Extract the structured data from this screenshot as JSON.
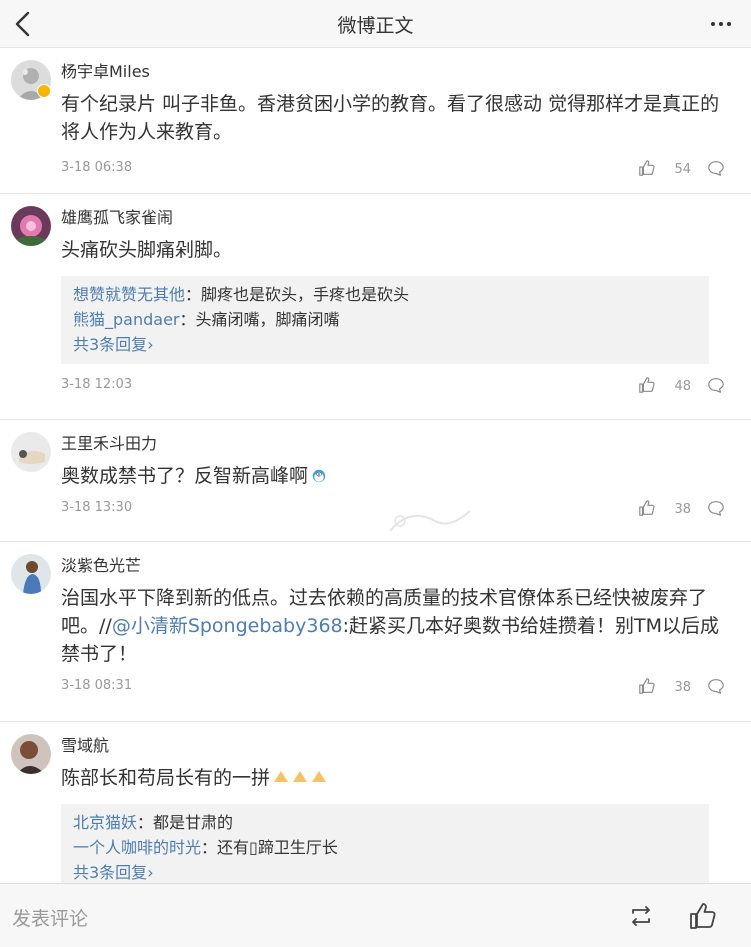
{
  "header": {
    "title": "微博正文"
  },
  "colors": {
    "link": "#507daf",
    "verified": "#f7b500"
  },
  "comments": [
    {
      "user": "杨宇卓Miles",
      "text": "有个纪录片 叫子非鱼。香港贫困小学的教育。看了很感动 觉得那样才是真正的将人作为人来教育。",
      "time": "3-18 06:38",
      "likes": "54",
      "verified": true
    },
    {
      "user": "雄鹰孤飞家雀闹",
      "text": "头痛砍头脚痛剁脚。",
      "time": "3-18 12:03",
      "likes": "48",
      "replies": [
        {
          "name": "想赞就赞无其他",
          "text": "：脚疼也是砍头，手疼也是砍头"
        },
        {
          "name": "熊猫_pandaer",
          "text": "：头痛闭嘴，脚痛闭嘴"
        }
      ],
      "more_replies": "共3条回复"
    },
    {
      "user": "王里禾斗田力",
      "text": "奥数成禁书了？反智新高峰啊",
      "emoji": "doraemon-emoji",
      "time": "3-18 13:30",
      "likes": "38"
    },
    {
      "user": "淡紫色光芒",
      "text_before": "治国水平下降到新的低点。过去依赖的高质量的技术官僚体系已经快被废弃了吧。//",
      "mention": "@小清新Spongebaby368",
      "text_after": ":赶紧买几本好奥数书给娃攒着！别TM以后成禁书了！",
      "time": "3-18 08:31",
      "likes": "38"
    },
    {
      "user": "雪域航",
      "text": "陈部长和苟局长有的一拼",
      "emoji": "clap-emoji",
      "replies": [
        {
          "name": "北京猫妖",
          "text": "：都是甘肃的"
        },
        {
          "name": "一个人咖啡的时光",
          "text": "：还有▯蹄卫生厅长"
        }
      ],
      "more_replies": "共3条回复"
    }
  ],
  "bottom": {
    "placeholder": "发表评论"
  },
  "icons": [
    "back-icon",
    "more-icon",
    "like-icon",
    "comment-icon",
    "repost-icon",
    "verified-icon"
  ]
}
